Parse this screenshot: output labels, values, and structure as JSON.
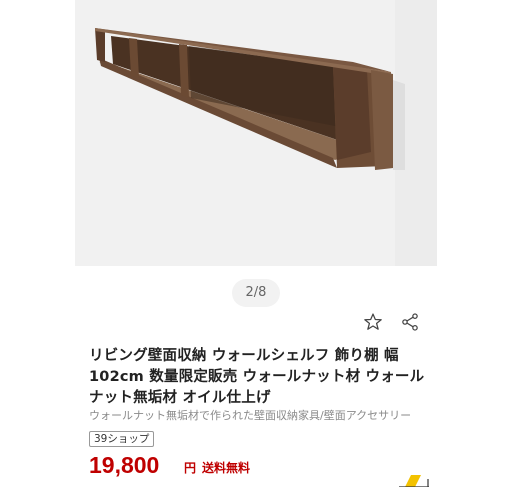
{
  "gallery": {
    "image_alt": "Walnut wall shelf",
    "watermark": "",
    "pager": "2/8"
  },
  "product": {
    "title": "リビング壁面収納 ウォールシェルフ 飾り棚 幅102cm 数量限定販売 ウォールナット材 ウォールナット無垢材 オイル仕上げ",
    "subtitle": "ウォールナット無垢材で作られた壁面収納家具/壁面アクセサリー",
    "shop_badge": "39ショップ",
    "price": "19,800",
    "currency": "円",
    "shipping": "送料無料"
  },
  "icons": {
    "favorite": "star-outline-icon",
    "share": "share-icon",
    "corner": "delivery-icon"
  },
  "colors": {
    "price": "#bf0000",
    "wood": "#6b4a33",
    "pager_bg": "#f2f2f2"
  }
}
